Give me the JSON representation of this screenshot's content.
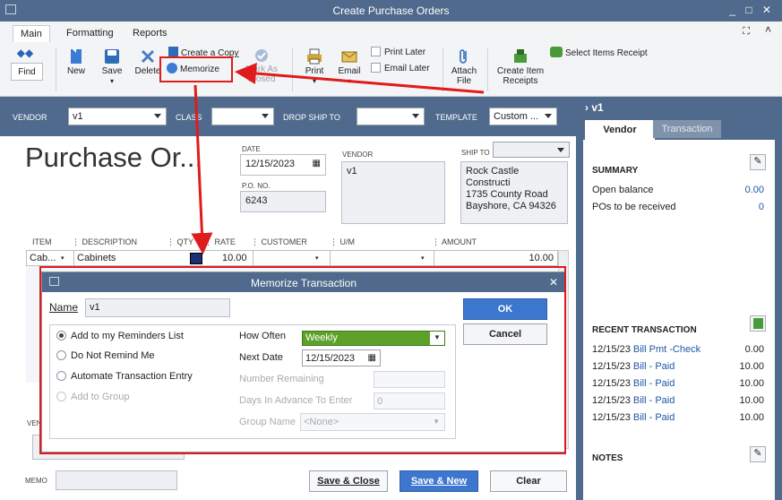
{
  "window": {
    "title": "Create Purchase Orders"
  },
  "ribbon": {
    "tabs": [
      "Main",
      "Formatting",
      "Reports"
    ],
    "buttons": {
      "find": "Find",
      "new": "New",
      "save": "Save",
      "delete": "Delete",
      "create_copy": "Create a Copy",
      "memorize": "Memorize",
      "mark_as_closed_1": "Mark As",
      "mark_as_closed_2": "Closed",
      "print": "Print",
      "email": "Email",
      "print_later": "Print Later",
      "email_later": "Email Later",
      "attach_1": "Attach",
      "attach_2": "File",
      "create_item_receipts_1": "Create Item",
      "create_item_receipts_2": "Receipts",
      "select_items_receipt": "Select Items Receipt"
    }
  },
  "header": {
    "vendor_label": "VENDOR",
    "vendor_value": "v1",
    "class_label": "CLASS",
    "drop_ship_label": "DROP SHIP TO",
    "template_label": "TEMPLATE",
    "template_value": "Custom ..."
  },
  "form": {
    "title": "Purchase Or...",
    "date_label": "DATE",
    "date_value": "12/15/2023",
    "po_label": "P.O. NO.",
    "po_value": "6243",
    "vendor_label": "VENDOR",
    "vendor_value": "v1",
    "shipto_label": "SHIP TO",
    "shipto_lines": [
      "Rock Castle Constructi",
      "1735 County Road",
      "Bayshore, CA 94326"
    ],
    "columns": [
      "ITEM",
      "DESCRIPTION",
      "QTY",
      "RATE",
      "CUSTOMER",
      "U/M",
      "AMOUNT"
    ],
    "row": {
      "item": "Cab...",
      "description": "Cabinets",
      "rate": "10.00",
      "amount": "10.00"
    },
    "vendor_msg_label": "VEN",
    "memo_label": "MEMO",
    "save_close": "Save & Close",
    "save_new": "Save & New",
    "clear": "Clear"
  },
  "right_panel": {
    "name": "v1",
    "tabs": [
      "Vendor",
      "Transaction"
    ],
    "summary_title": "SUMMARY",
    "summary": [
      {
        "label": "Open balance",
        "value": "0.00"
      },
      {
        "label": "POs to be received",
        "value": "0"
      }
    ],
    "recent_title": "RECENT TRANSACTION",
    "recent": [
      {
        "date": "12/15/23",
        "type": "Bill Pmt -Check",
        "amount": "0.00"
      },
      {
        "date": "12/15/23",
        "type": "Bill - Paid",
        "amount": "10.00"
      },
      {
        "date": "12/15/23",
        "type": "Bill - Paid",
        "amount": "10.00"
      },
      {
        "date": "12/15/23",
        "type": "Bill - Paid",
        "amount": "10.00"
      },
      {
        "date": "12/15/23",
        "type": "Bill - Paid",
        "amount": "10.00"
      }
    ],
    "notes_title": "NOTES"
  },
  "dialog": {
    "title": "Memorize Transaction",
    "name_label": "Name",
    "name_value": "v1",
    "ok": "OK",
    "cancel": "Cancel",
    "options": [
      "Add to my Reminders List",
      "Do Not Remind Me",
      "Automate Transaction Entry",
      "Add to Group"
    ],
    "how_often_label": "How Often",
    "how_often_value": "Weekly",
    "next_date_label": "Next Date",
    "next_date_value": "12/15/2023",
    "number_remaining_label": "Number Remaining",
    "days_in_advance_label": "Days In Advance To Enter",
    "days_in_advance_value": "0",
    "group_name_label": "Group Name",
    "group_name_value": "<None>"
  },
  "colors": {
    "header": "#4f6a8c",
    "annotation": "#e01b1b",
    "weekly_green": "#5ea12a",
    "ok_blue": "#3c76cf"
  }
}
